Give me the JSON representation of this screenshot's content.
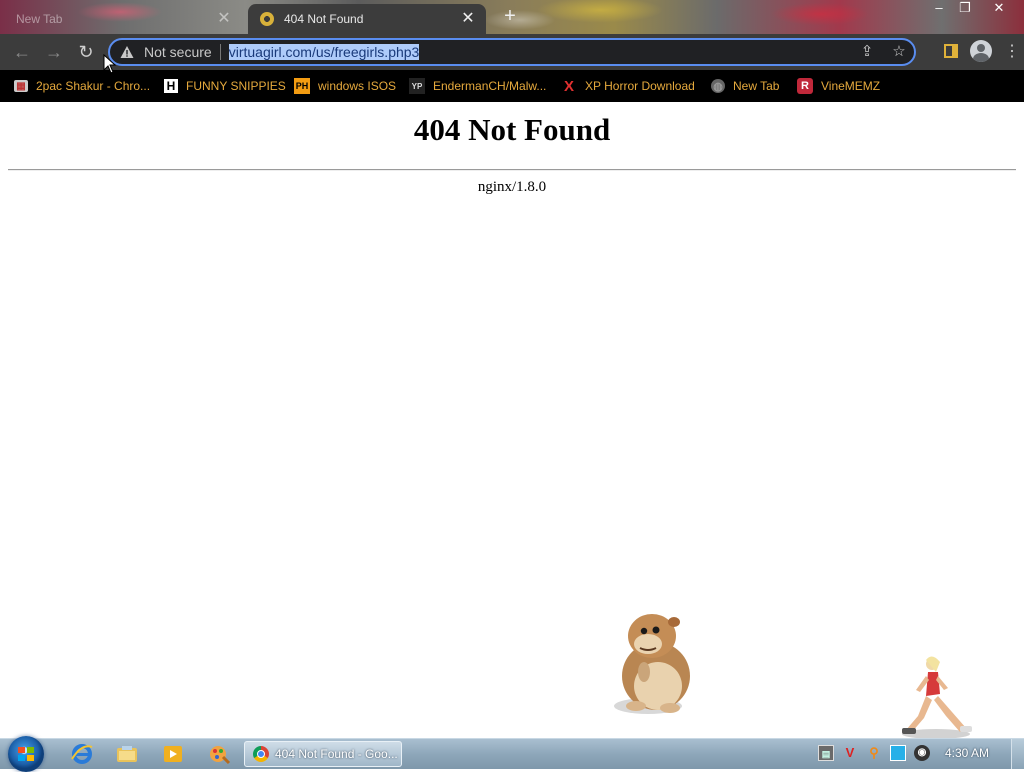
{
  "browser": {
    "tabs": [
      {
        "title": "New Tab",
        "active": false
      },
      {
        "title": "404 Not Found",
        "active": true
      }
    ],
    "new_tab_symbol": "+",
    "window_controls": [
      "–",
      "❐",
      "✕"
    ],
    "security_label": "Not secure",
    "url": "virtuagirl.com/us/freegirls.php3",
    "bookmarks": [
      {
        "label": "2pac Shakur - Chro...",
        "icon": "bookmark-folder-icon"
      },
      {
        "label": "FUNNY SNIPPIES",
        "icon": "h-letter-icon"
      },
      {
        "label": "windows ISOS",
        "icon": "ph-icon"
      },
      {
        "label": "EndermanCH/Malw...",
        "icon": "yp-icon"
      },
      {
        "label": "XP Horror Download",
        "icon": "x-red-icon"
      },
      {
        "label": "New Tab",
        "icon": "globe-icon"
      },
      {
        "label": "VineMEMZ",
        "icon": "r-red-icon"
      }
    ],
    "bookmark_color": "#e5a93d",
    "omnibox_border_color": "#5a8df0"
  },
  "page": {
    "heading": "404 Not Found",
    "server": "nginx/1.8.0"
  },
  "taskbar": {
    "task_label": "404 Not Found - Goo...",
    "clock": "4:30 AM",
    "pinned": [
      "ie-icon",
      "explorer-folder-icon",
      "media-player-icon",
      "paint-icon"
    ],
    "tray": [
      "network-monitor-icon",
      "v-red-icon",
      "search-orange-icon",
      "display-icon",
      "speaker-icon"
    ]
  }
}
